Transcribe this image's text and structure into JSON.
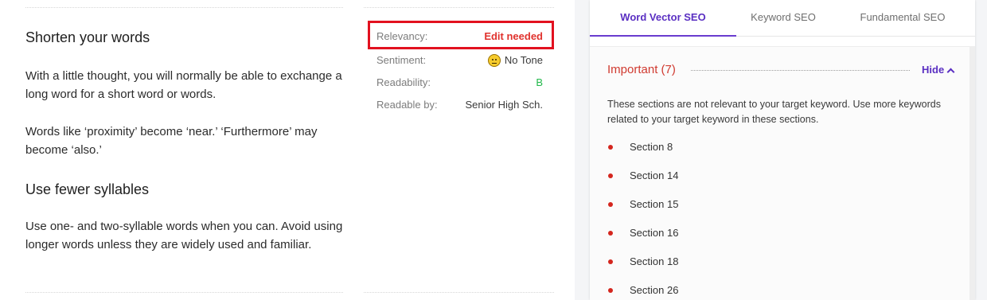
{
  "article": {
    "heading_1": "Shorten your words",
    "paragraph_1": "With a little thought, you will normally be able to exchange a long word for a short word or words.",
    "paragraph_2": "Words like ‘proximity’ become ‘near.’ ‘Furthermore’ may become ‘also.’",
    "heading_2": "Use fewer syllables",
    "paragraph_3": "Use one- and two-syllable words when you can. Avoid using longer words unless they are widely used and familiar."
  },
  "metrics": {
    "relevancy_label": "Relevancy:",
    "relevancy_value": "Edit needed",
    "sentiment_label": "Sentiment:",
    "sentiment_value": "No Tone",
    "sentiment_icon": "neutral-face-icon",
    "readability_label": "Readability:",
    "readability_value": "B",
    "readable_by_label": "Readable by:",
    "readable_by_value": "Senior High Sch."
  },
  "panel": {
    "tabs": [
      {
        "label": "Word Vector SEO",
        "active": true
      },
      {
        "label": "Keyword SEO",
        "active": false
      },
      {
        "label": "Fundamental SEO",
        "active": false
      }
    ],
    "important": {
      "title": "Important (7)",
      "toggle_label": "Hide",
      "toggle_icon": "chevron-up-icon",
      "description": "These sections are not relevant to your target keyword. Use more keywords related to your target keyword in these sections.",
      "sections": [
        "Section 8",
        "Section 14",
        "Section 15",
        "Section 16",
        "Section 18",
        "Section 26"
      ]
    }
  },
  "colors": {
    "accent": "#5a2fc2",
    "warning": "#e0322d",
    "highlight_box": "#e2111f",
    "good_grade": "#22b84b",
    "bullet": "#d4261e"
  }
}
